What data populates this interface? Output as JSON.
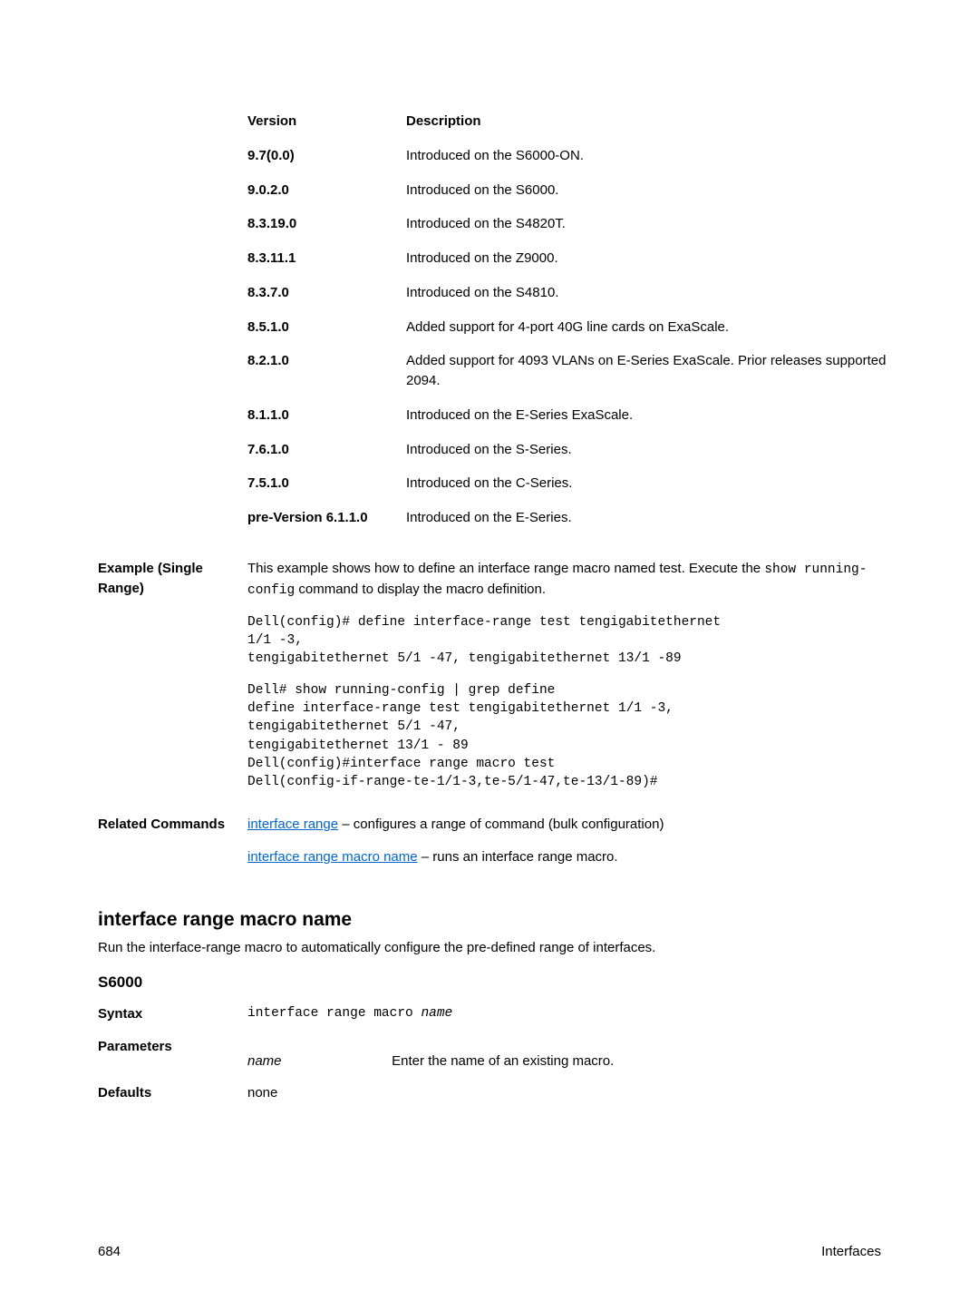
{
  "version_table": {
    "header": {
      "version": "Version",
      "description": "Description"
    },
    "rows": [
      {
        "version": "9.7(0.0)",
        "description": "Introduced on the S6000-ON."
      },
      {
        "version": "9.0.2.0",
        "description": "Introduced on the S6000."
      },
      {
        "version": "8.3.19.0",
        "description": "Introduced on the S4820T."
      },
      {
        "version": "8.3.11.1",
        "description": "Introduced on the Z9000."
      },
      {
        "version": "8.3.7.0",
        "description": "Introduced on the S4810."
      },
      {
        "version": "8.5.1.0",
        "description": "Added support for 4-port 40G line cards on ExaScale."
      },
      {
        "version": "8.2.1.0",
        "description": "Added support for 4093 VLANs on E-Series ExaScale. Prior releases supported 2094."
      },
      {
        "version": "8.1.1.0",
        "description": "Introduced on the E-Series ExaScale."
      },
      {
        "version": "7.6.1.0",
        "description": "Introduced on the S-Series."
      },
      {
        "version": "7.5.1.0",
        "description": "Introduced on the C-Series."
      },
      {
        "version": "pre-Version 6.1.1.0",
        "description": "Introduced on the E-Series."
      }
    ]
  },
  "example": {
    "label": "Example (Single Range)",
    "intro_pre": "This example shows how to define an interface range macro named test. Execute the ",
    "intro_code": "show running-config",
    "intro_post": " command to display the macro definition.",
    "block1": "Dell(config)# define interface-range test tengigabitethernet\n1/1 -3,\ntengigabitethernet 5/1 -47, tengigabitethernet 13/1 -89",
    "block2": "Dell# show running-config | grep define\ndefine interface-range test tengigabitethernet 1/1 -3,\ntengigabitethernet 5/1 -47,\ntengigabitethernet 13/1 - 89\nDell(config)#interface range macro test\nDell(config-if-range-te-1/1-3,te-5/1-47,te-13/1-89)#"
  },
  "related": {
    "label": "Related Commands",
    "link1_text": "interface range",
    "link1_desc": " – configures a range of command (bulk configuration)",
    "link2_text": "interface range macro name",
    "link2_desc": " – runs an interface range macro."
  },
  "section2": {
    "heading": "interface range macro name",
    "desc": "Run the interface-range macro to automatically configure the pre-defined range of interfaces.",
    "model": "S6000",
    "syntax_label": "Syntax",
    "syntax_code_pre": "interface range macro ",
    "syntax_code_italic": "name",
    "params_label": "Parameters",
    "param_name": "name",
    "param_desc": "Enter the name of an existing macro.",
    "defaults_label": "Defaults",
    "defaults_value": "none"
  },
  "footer": {
    "page": "684",
    "title": "Interfaces"
  }
}
